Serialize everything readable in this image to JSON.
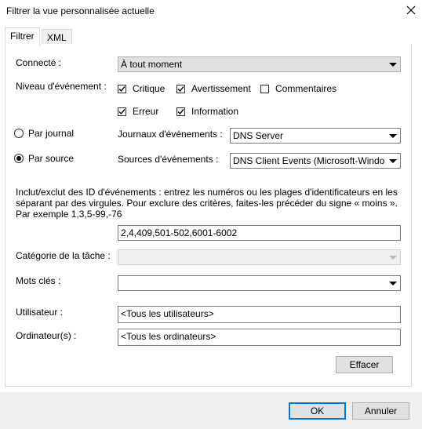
{
  "window": {
    "title": "Filtrer la vue personnalisée actuelle"
  },
  "tabs": [
    {
      "label": "Filtrer",
      "active": true
    },
    {
      "label": "XML",
      "active": false
    }
  ],
  "connected": {
    "label": "Connecté :",
    "value": "À tout moment"
  },
  "level": {
    "label": "Niveau d'événement :",
    "items": [
      {
        "label": "Critique",
        "checked": true
      },
      {
        "label": "Avertissement",
        "checked": true
      },
      {
        "label": "Commentaires",
        "checked": false
      },
      {
        "label": "Erreur",
        "checked": true
      },
      {
        "label": "Information",
        "checked": true
      }
    ]
  },
  "by_log": {
    "label": "Par journal",
    "selected": false,
    "field_label": "Journaux d'événements :",
    "value": "DNS Server"
  },
  "by_source": {
    "label": "Par source",
    "selected": true,
    "field_label": "Sources d'événements :",
    "value": "DNS Client Events (Microsoft-Windo"
  },
  "event_ids": {
    "description_line1": "Inclut/exclut des ID d'événements : entrez les numéros ou les plages d'identificateurs en les",
    "description_line2": "séparant par des virgules. Pour exclure des critères, faites-les précéder du signe « moins ».",
    "description_line3": "Par exemple 1,3,5-99,-76",
    "value": "2,4,409,501-502,6001-6002"
  },
  "task_category": {
    "label": "Catégorie de la tâche :",
    "value": ""
  },
  "keywords": {
    "label": "Mots clés :",
    "value": ""
  },
  "user": {
    "label": "Utilisateur :",
    "value": "<Tous les utilisateurs>"
  },
  "computer": {
    "label": "Ordinateur(s) :",
    "value": "<Tous les ordinateurs>"
  },
  "buttons": {
    "clear": "Effacer",
    "ok": "OK",
    "cancel": "Annuler"
  },
  "colors": {
    "accent": "#0078d7",
    "button_face": "#e1e1e1",
    "dialog_bottom": "#f0f0f0"
  },
  "icons": {
    "close": "close-icon",
    "checkmark": "checkmark-icon",
    "dropdown": "chevron-down-icon"
  }
}
